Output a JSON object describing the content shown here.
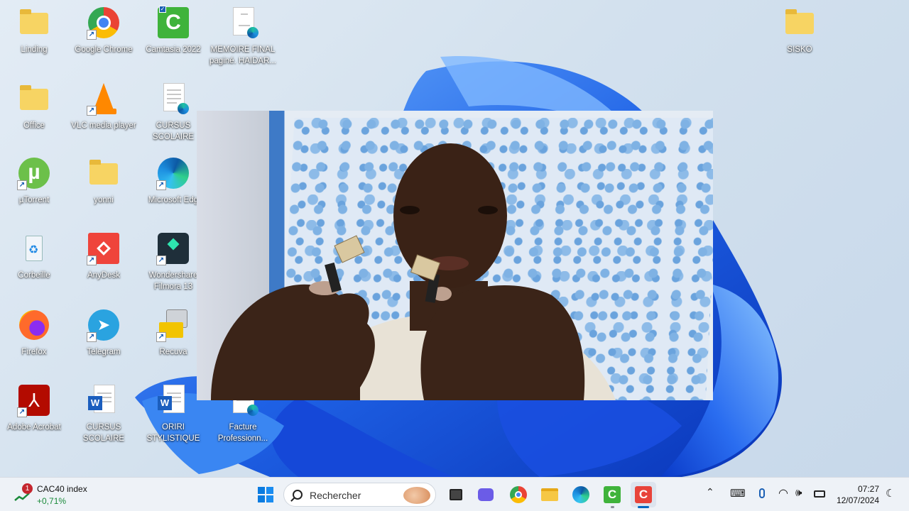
{
  "desktop_icons": [
    {
      "id": "linding",
      "label": "Linding",
      "icon": "folder-icon"
    },
    {
      "id": "google-chrome",
      "label": "Google Chrome",
      "icon": "chrome-icon"
    },
    {
      "id": "camtasia-2022",
      "label": "Camtasia 2022",
      "icon": "camtasia-icon"
    },
    {
      "id": "memoire-final",
      "label": "MEMOIRE FINAL\npaginé. HAIDAR...",
      "icon": "pdf-document-icon"
    },
    {
      "id": "sisko",
      "label": "SISKO",
      "icon": "folder-icon"
    },
    {
      "id": "office",
      "label": "Office",
      "icon": "folder-icon"
    },
    {
      "id": "vlc",
      "label": "VLC media player",
      "icon": "vlc-icon"
    },
    {
      "id": "cursus-scolaire-pdf",
      "label": "CURSUS\nSCOLAIRE",
      "icon": "pdf-document-icon"
    },
    {
      "id": "utorrent",
      "label": "µTorrent",
      "icon": "utorrent-icon"
    },
    {
      "id": "yonni",
      "label": "yonni",
      "icon": "folder-icon"
    },
    {
      "id": "microsoft-edge",
      "label": "Microsoft Edg",
      "icon": "edge-icon"
    },
    {
      "id": "corbeille",
      "label": "Corbeille",
      "icon": "recycle-bin-icon"
    },
    {
      "id": "anydesk",
      "label": "AnyDesk",
      "icon": "anydesk-icon"
    },
    {
      "id": "filmora",
      "label": "Wondershare\nFilmora 13",
      "icon": "filmora-icon"
    },
    {
      "id": "firefox",
      "label": "Firefox",
      "icon": "firefox-icon"
    },
    {
      "id": "telegram",
      "label": "Telegram",
      "icon": "telegram-icon"
    },
    {
      "id": "recuva",
      "label": "Recuva",
      "icon": "recuva-icon"
    },
    {
      "id": "adobe-acrobat",
      "label": "Adobe Acrobat",
      "icon": "acrobat-icon"
    },
    {
      "id": "cursus-scolaire-word",
      "label": "CURSUS\nSCOLAIRE",
      "icon": "word-icon"
    },
    {
      "id": "oriri-stylistique",
      "label": "ORIRI\nSTYLISTIQUE",
      "icon": "word-icon"
    },
    {
      "id": "facture",
      "label": "Facture\nProfessionn...",
      "icon": "document-icon"
    }
  ],
  "taskbar": {
    "widget": {
      "badge": "1",
      "title": "CAC40 index",
      "change": "+0,71%",
      "change_color": "#1a8a3a"
    },
    "search_placeholder": "Rechercher",
    "apps": [
      "start-icon",
      "task-view-icon",
      "teams-icon",
      "chrome-icon",
      "file-explorer-icon",
      "edge-icon",
      "camtasia-icon",
      "camtasia-recorder-icon"
    ],
    "clock": {
      "time": "07:27",
      "date": "12/07/2024"
    }
  },
  "colors": {
    "bloom_dark": "#0b3fd1",
    "bloom_light": "#3f8ff5",
    "taskbar_bg": "#eef2f7",
    "accent": "#0067c0"
  }
}
